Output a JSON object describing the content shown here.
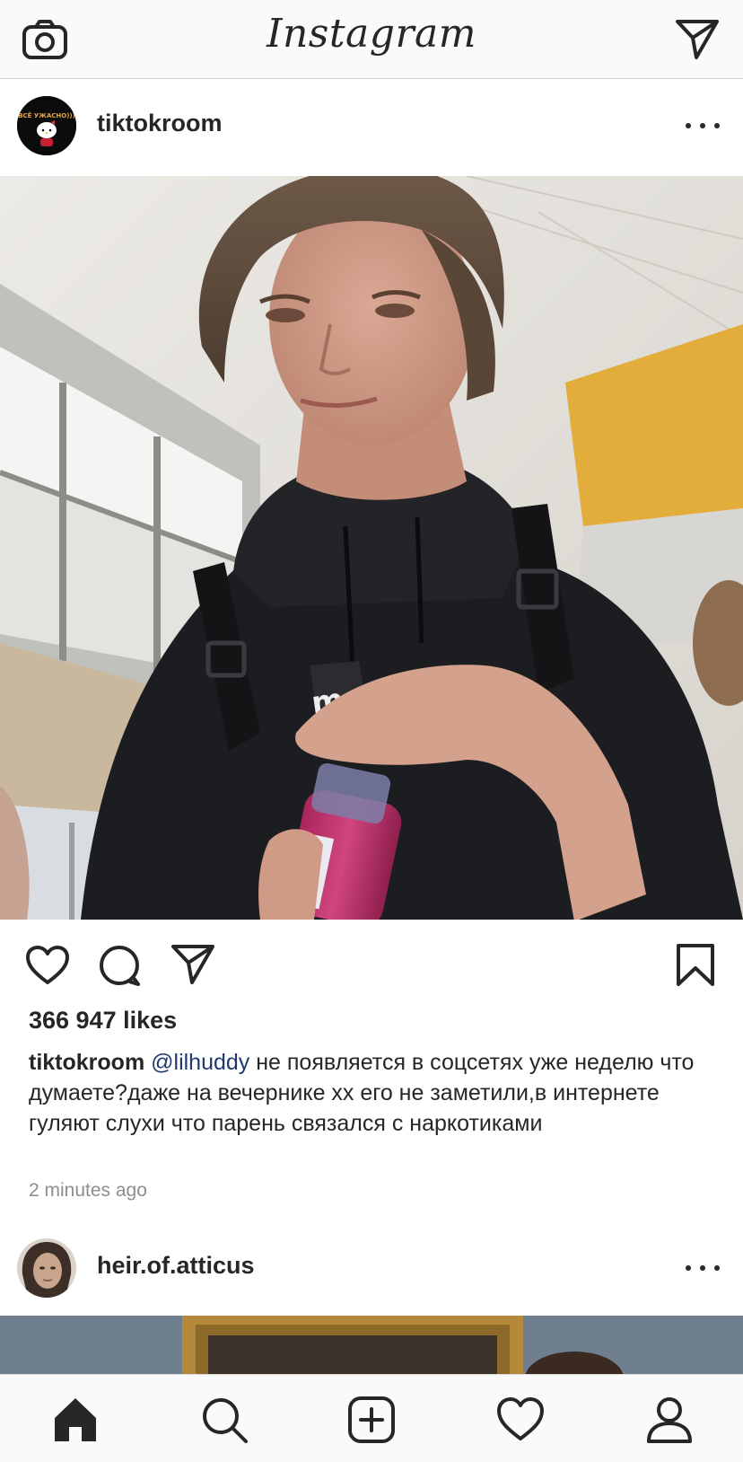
{
  "app": {
    "title": "Instagram"
  },
  "posts": [
    {
      "username": "tiktokroom",
      "avatar_text": "ВСЁ УЖАСНО)))",
      "likes": "366 947 likes",
      "caption": {
        "username": "tiktokroom",
        "mention": "@lilhuddy",
        "text": " не появляется в соцсетях уже неделю что думаете?даже на вечернике хх его не заметили,в интернете гуляют слухи что парень связался с наркотиками"
      },
      "time_ago": "2 minutes ago",
      "image_overlay_text": "me"
    },
    {
      "username": "heir.of.atticus"
    }
  ],
  "icons": {
    "camera": "camera-icon",
    "direct": "direct-message-icon",
    "more": "more-options-icon",
    "like": "heart-icon",
    "comment": "comment-icon",
    "share": "share-icon",
    "save": "bookmark-icon",
    "home": "home-icon",
    "search": "search-icon",
    "new_post": "new-post-icon",
    "activity": "activity-heart-icon",
    "profile": "profile-icon"
  },
  "colors": {
    "text": "#262626",
    "mention": "#1e3a6e",
    "muted": "#8e8e8e",
    "bar_bg": "#fafafa"
  }
}
